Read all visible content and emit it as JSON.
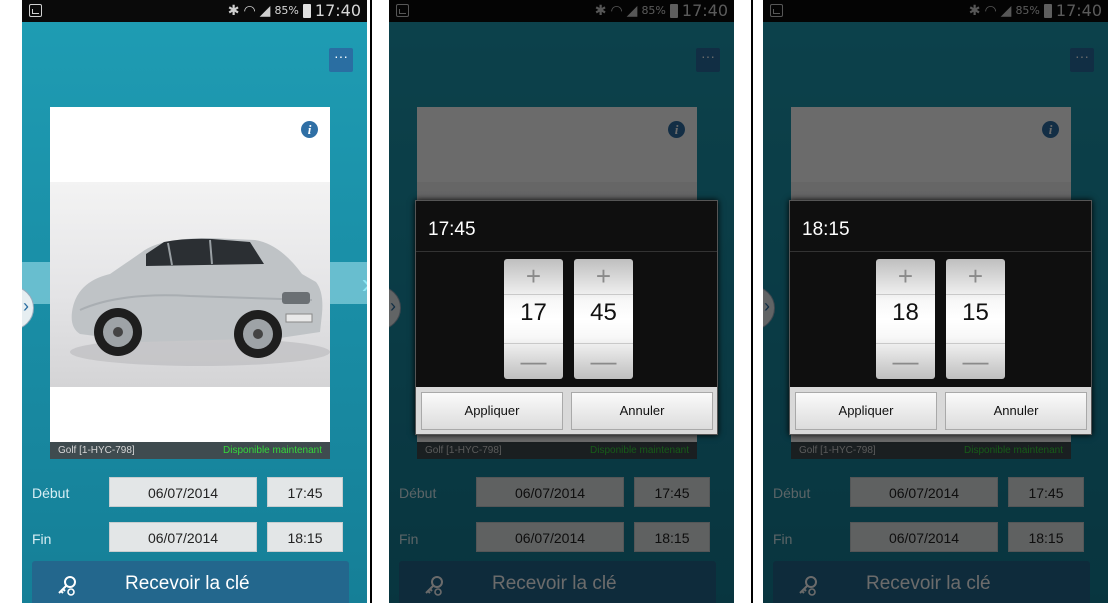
{
  "statusbar": {
    "battery": "85%",
    "time": "17:40"
  },
  "overflow_label": "···",
  "car": {
    "name": "Golf [1-HYC-798]",
    "status": "Disponible maintenant"
  },
  "labels": {
    "start": "Début",
    "end": "Fin"
  },
  "start": {
    "date": "06/07/2014",
    "time": "17:45"
  },
  "end": {
    "date": "06/07/2014",
    "time": "18:15"
  },
  "receive_button": "Recevoir la clé",
  "dialog1": {
    "title": "17:45",
    "hour": "17",
    "minute": "45"
  },
  "dialog2": {
    "title": "18:15",
    "hour": "18",
    "minute": "15"
  },
  "dialog_buttons": {
    "apply": "Appliquer",
    "cancel": "Annuler"
  },
  "picker_glyphs": {
    "plus": "+",
    "minus": "—"
  },
  "colors": {
    "accent": "#1f9db4",
    "button": "#23678d",
    "available": "#35d63a"
  }
}
